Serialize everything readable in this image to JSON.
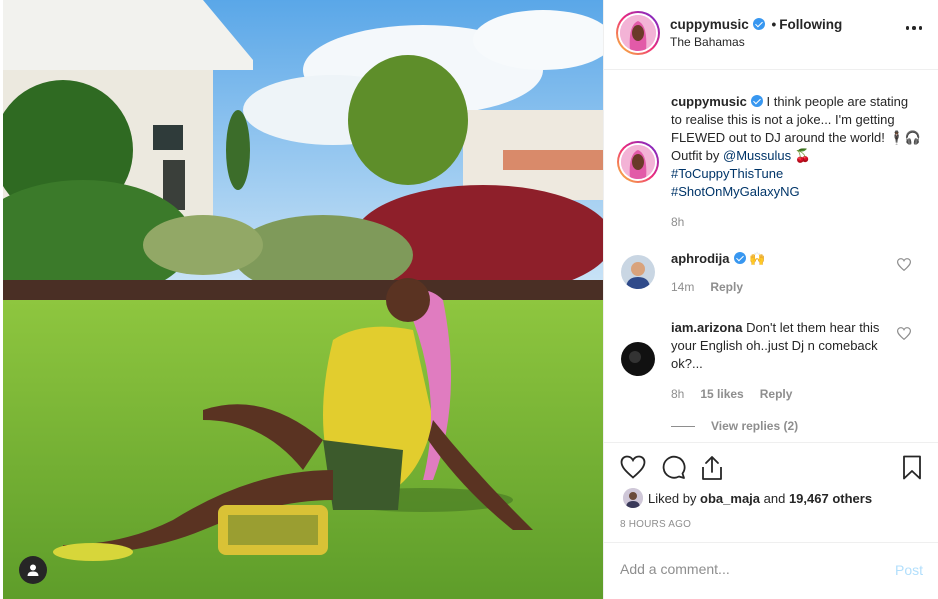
{
  "post": {
    "username": "cuppymusic",
    "follow_status": "Following",
    "separator": "•",
    "location": "The Bahamas"
  },
  "caption": {
    "username": "cuppymusic",
    "text_1": "I think people are stating to realise this is not a joke... I'm getting FLEWED out to DJ around the world! 🕴🏾🎧 Outfit by ",
    "mention": "@Mussulus",
    "text_2": " 🍒",
    "hashtag_1": "#ToCuppyThisTune",
    "hashtag_2": "#ShotOnMyGalaxyNG",
    "time": "8h"
  },
  "comments": [
    {
      "username": "aphrodija",
      "text": "🙌",
      "time": "14m",
      "likes": "",
      "reply_label": "Reply"
    },
    {
      "username": "iam.arizona",
      "text": "Don't let them hear this your English oh..just Dj n comeback ok?...",
      "time": "8h",
      "likes": "15 likes",
      "reply_label": "Reply"
    }
  ],
  "view_replies": "View replies (2)",
  "likes": {
    "prefix": "Liked by ",
    "user": "oba_maja",
    "middle": " and ",
    "count": "19,467 others"
  },
  "time_ago": "8 HOURS AGO",
  "add_comment": {
    "placeholder": "Add a comment...",
    "post_label": "Post"
  },
  "icons": {
    "like": "heart-icon",
    "comment": "comment-icon",
    "share": "share-icon",
    "save": "bookmark-icon",
    "more": "more-options-icon",
    "user_tag": "user-tag-icon"
  },
  "colors": {
    "verified": "#3897f0",
    "link": "#003569",
    "post_disabled": "#b2dffc",
    "muted": "#8e8e8e"
  }
}
